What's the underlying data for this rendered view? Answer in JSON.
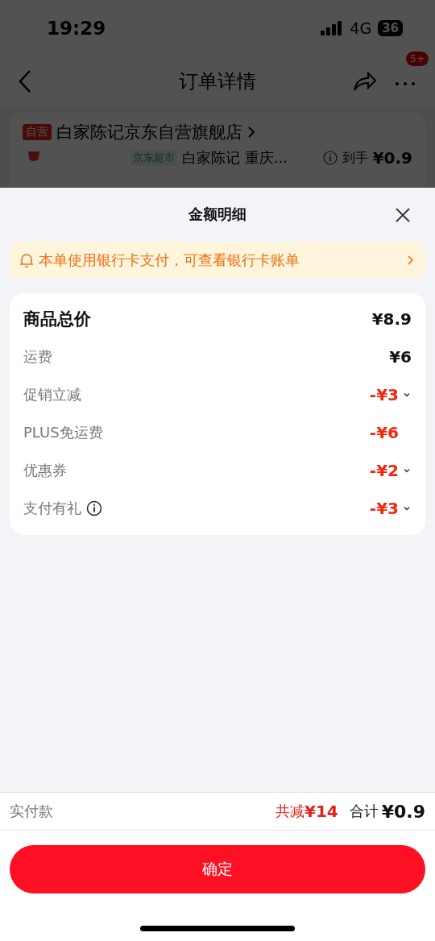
{
  "status_bar": {
    "time": "19:29",
    "network": "4G",
    "battery": "36"
  },
  "nav": {
    "title": "订单详情",
    "badge": "5+"
  },
  "store": {
    "tag": "自营",
    "name": "白家陈记京东自营旗舰店",
    "product_tag": "京东超市",
    "product_name": "白家陈记 重庆...",
    "price_label": "到手",
    "price": "¥0.9"
  },
  "sheet": {
    "title": "金额明细",
    "notice": "本单使用银行卡支付，可查看银行卡账单",
    "rows": [
      {
        "kind": "total",
        "label": "商品总价",
        "amount": "¥8.9",
        "info": false,
        "expandable": false
      },
      {
        "kind": "charge",
        "label": "运费",
        "amount": "¥6",
        "info": false,
        "expandable": false
      },
      {
        "kind": "discount",
        "label": "促销立减",
        "amount": "-¥3",
        "info": false,
        "expandable": true
      },
      {
        "kind": "discount",
        "label": "PLUS免运费",
        "amount": "-¥6",
        "info": false,
        "expandable": false
      },
      {
        "kind": "discount",
        "label": "优惠券",
        "amount": "-¥2",
        "info": false,
        "expandable": true
      },
      {
        "kind": "discount",
        "label": "支付有礼",
        "amount": "-¥3",
        "info": true,
        "expandable": true
      }
    ]
  },
  "footer": {
    "label": "实付款",
    "saved_label": "共减",
    "saved": "¥14",
    "total_label": "合计",
    "total": "¥0.9"
  },
  "button": "确定"
}
